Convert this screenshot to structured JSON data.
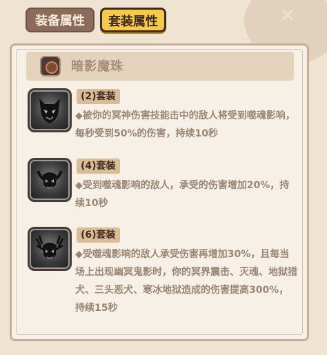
{
  "tabs": [
    {
      "label": "装备属性",
      "active": false
    },
    {
      "label": "套装属性",
      "active": true
    }
  ],
  "header": {
    "title": "暗影魔珠",
    "icon": "orb-icon"
  },
  "sets": [
    {
      "badge": "(2)套装",
      "icon": "demon-mask-icon",
      "description": "◆被你的冥神伤害技能击中的敌人将受到噬魂影响，每秒受到50%的伤害，持续10秒"
    },
    {
      "badge": "(4)套装",
      "icon": "horned-skull-icon",
      "description": "◆受到噬魂影响的敌人，承受的伤害增加20%，持续10秒"
    },
    {
      "badge": "(6)套装",
      "icon": "antler-skull-icon",
      "description": "◆受噬魂影响的敌人承受伤害再增加30%，且每当场上出现幽冥鬼影时，你的冥界震击、灭魂、地狱猎犬、三头恶犬、寒冰地狱造成的伤害提高300%，持续15秒"
    }
  ],
  "colors": {
    "background": "#efe4d2",
    "active_tab": "#f6c94a",
    "inactive_tab": "#8b6b5a",
    "text": "#9a8677"
  }
}
